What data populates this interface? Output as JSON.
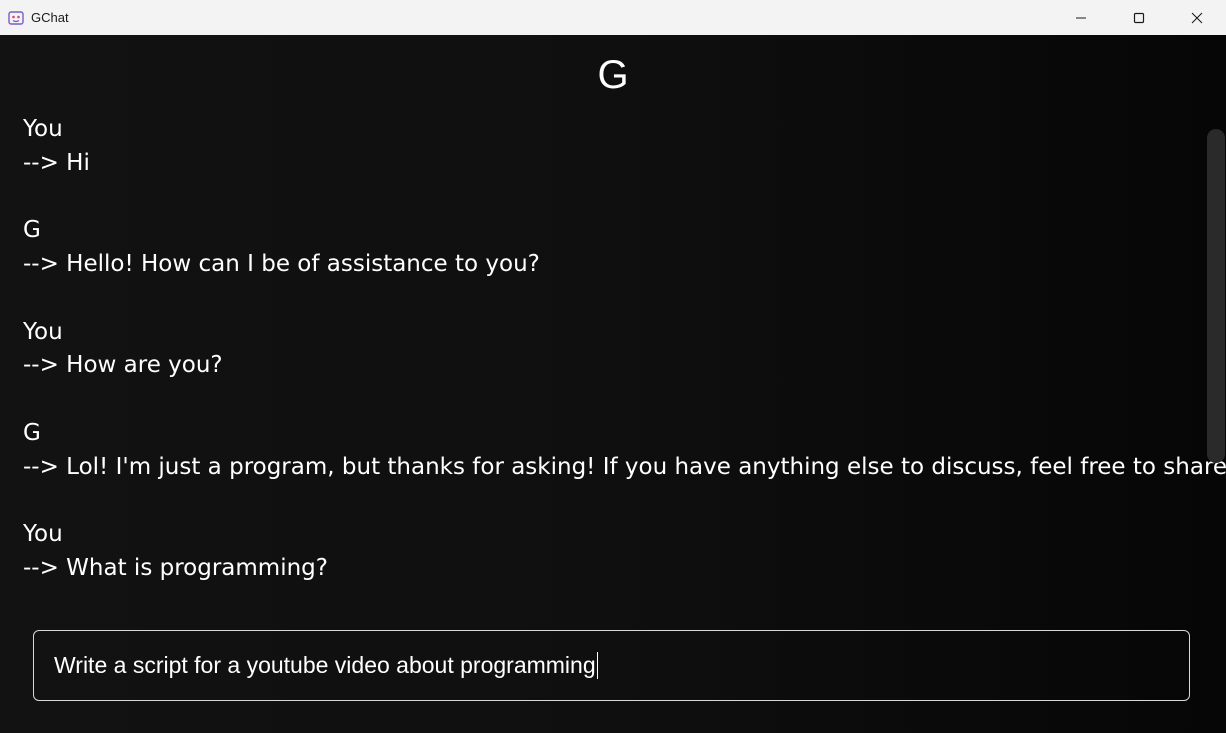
{
  "window": {
    "title": "GChat",
    "icon": "app-face-icon",
    "controls": [
      "minimize-icon",
      "maximize-icon",
      "close-icon"
    ]
  },
  "header": {
    "title": "G"
  },
  "messages": [
    {
      "sender": "You",
      "text": "--> Hi"
    },
    {
      "sender": "G",
      "text": "--> Hello! How can I be of assistance to you?"
    },
    {
      "sender": "You",
      "text": "--> How are you?"
    },
    {
      "sender": "G",
      "text": "--> Lol! I'm just a program, but thanks for asking! If you have anything else to discuss, feel free to share."
    },
    {
      "sender": "You",
      "text": "--> What is programming?"
    }
  ],
  "input": {
    "value": "Write a script for a youtube video about programming"
  },
  "colors": {
    "background": "#0f0f0f",
    "text": "#ffffff",
    "titlebar": "#f3f3f3",
    "input_border": "#d8d8d8"
  }
}
